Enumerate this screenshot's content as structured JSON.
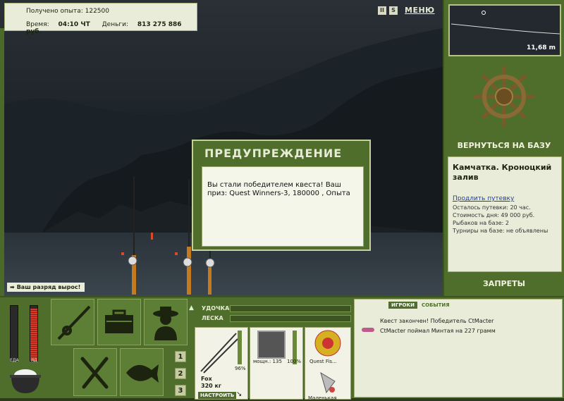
{
  "stats": {
    "experience_label": "Получено опыта:",
    "experience_value": "122500",
    "time_label": "Время:",
    "time_value": "04:10 ЧТ",
    "money_label": "Деньги:",
    "money_value": "813 275 886 руб."
  },
  "top_controls": {
    "pause_glyph": "II",
    "sound_glyph": "S",
    "menu_label": "МЕНЮ"
  },
  "depth": {
    "value": "11,68 m"
  },
  "right_panel": {
    "return_label": "ВЕРНУТЬСЯ НА БАЗУ",
    "location_title": "Камчатка. Кроноцкий залив",
    "extend_link": "Продлить путевку",
    "info_lines": [
      "Осталось путевки: 20 час.",
      "Стоимость дня: 49 000 руб.",
      "Рыбаков на базе: 2",
      "Турниры на базе: не объявлены"
    ],
    "bans_label": "ЗАПРЕТЫ"
  },
  "rank_message": "Ваш разряд вырос!",
  "dialog": {
    "title": "ПРЕДУПРЕЖДЕНИЕ",
    "body": "Вы стали победителем квеста! Ваш приз: Quest Winners-3, 180000 , Опыта"
  },
  "meters": {
    "food_label": "ЕДА",
    "poison_label": "ЯД",
    "food_level": 0.0,
    "poison_level": 0.95
  },
  "number_buttons": [
    "1",
    "2",
    "3"
  ],
  "gear": {
    "rod_label": "УДОЧКА",
    "line_label": "ЛЕСКА",
    "rod_name": "Fox",
    "rod_weight": "320 кг",
    "rod_percent": "96%",
    "configure_label": "НАСТРОИТЬ",
    "reel_power": "мощн.: 135",
    "reel_percent": "100%",
    "line_name": "Quest Fis...",
    "lure_name": "Маленькая"
  },
  "events": {
    "tab_players": "ИГРОКИ",
    "tab_events": "СОБЫТИЯ",
    "lines": [
      "Квест закончен! Победитель CtMacter",
      "CtMacter поймал Минтая на 227 грамм"
    ]
  },
  "colors": {
    "panel_green": "#4f6e2c",
    "cream": "#e9ecd9",
    "link_blue": "#1a3ea8"
  }
}
